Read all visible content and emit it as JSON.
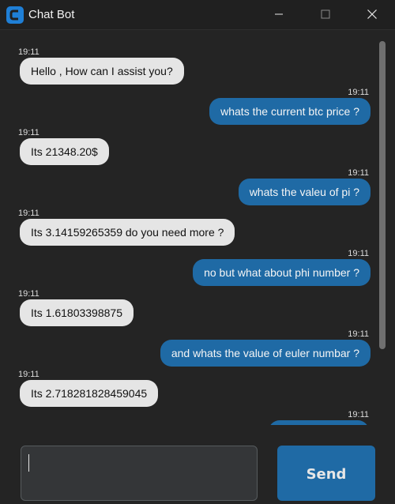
{
  "window": {
    "title": "Chat Bot",
    "accent": "#1f6aa5",
    "controls": [
      "minimize-icon",
      "maximize-icon",
      "close-icon"
    ]
  },
  "messages": [
    {
      "sender": "bot",
      "time": "19:11",
      "text": "Hello , How can I assist you?"
    },
    {
      "sender": "user",
      "time": "19:11",
      "text": "whats the current btc price ?"
    },
    {
      "sender": "bot",
      "time": "19:11",
      "text": "Its 21348.20$"
    },
    {
      "sender": "user",
      "time": "19:11",
      "text": "whats the valeu of pi ?"
    },
    {
      "sender": "bot",
      "time": "19:11",
      "text": "Its 3.14159265359 do you need more ?"
    },
    {
      "sender": "user",
      "time": "19:11",
      "text": "no but what about phi number ?"
    },
    {
      "sender": "bot",
      "time": "19:11",
      "text": "Its 1.61803398875"
    },
    {
      "sender": "user",
      "time": "19:11",
      "text": "and whats the value of euler numbar ?"
    },
    {
      "sender": "bot",
      "time": "19:11",
      "text": "Its 2.718281828459045"
    },
    {
      "sender": "user",
      "time": "19:11",
      "text": ""
    }
  ],
  "composer": {
    "input_value": "",
    "send_label": "Send"
  },
  "colors": {
    "background": "#242424",
    "bot_bubble": "#e5e5e5",
    "user_bubble": "#1f6aa5"
  }
}
